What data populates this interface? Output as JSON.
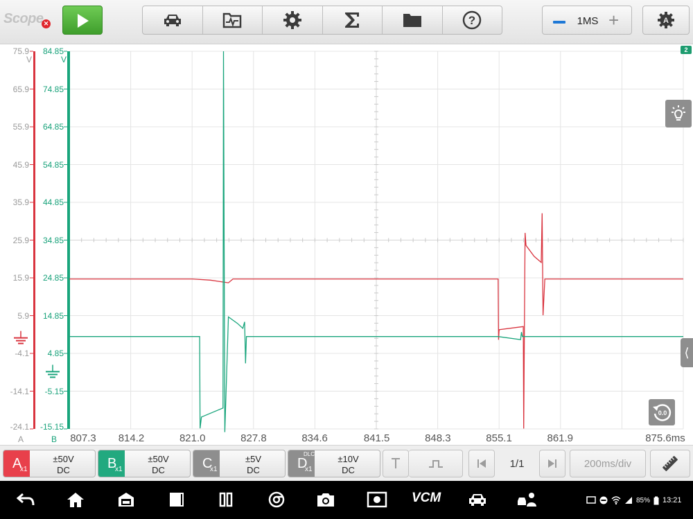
{
  "app": {
    "title": "Scope",
    "status_icon": "error-badge-icon"
  },
  "toolbar": {
    "run_icon": "play-icon",
    "tools": [
      {
        "name": "vehicle",
        "icon": "car-icon"
      },
      {
        "name": "waveform-library",
        "icon": "waveform-folder-icon"
      },
      {
        "name": "settings",
        "icon": "gear-icon"
      },
      {
        "name": "math",
        "icon": "sigma-icon"
      },
      {
        "name": "files",
        "icon": "folder-icon"
      },
      {
        "name": "help",
        "icon": "help-icon"
      }
    ],
    "timebase": {
      "value": "1MS",
      "minus_icon": "minus-icon",
      "plus_icon": "plus-icon"
    },
    "scope_settings_icon": "scope-settings-icon"
  },
  "plot": {
    "channel_a_labels": [
      "75.9",
      "65.9",
      "55.9",
      "45.9",
      "35.9",
      "25.9",
      "15.9",
      "5.9",
      "-4.1",
      "-14.1",
      "-24.1"
    ],
    "channel_b_labels": [
      "84.85",
      "74.85",
      "64.85",
      "54.85",
      "44.85",
      "34.85",
      "24.85",
      "14.85",
      "4.85",
      "-5.15",
      "-15.15"
    ],
    "unit_a": "V",
    "unit_b": "V",
    "x_labels": [
      "807.3",
      "814.2",
      "821.0",
      "827.8",
      "834.6",
      "841.5",
      "848.3",
      "855.1",
      "861.9",
      "875.6ms"
    ],
    "channel_a_name": "A",
    "channel_b_name": "B",
    "channel_b_badge": "2",
    "brightness_icon": "brightness-icon",
    "side_panel_icon": "chevron-left-icon",
    "reset_zoom_value": "0.0"
  },
  "chart_data": {
    "type": "line",
    "xlim": [
      807.3,
      875.6
    ],
    "x_unit": "ms",
    "series": [
      {
        "name": "A",
        "color": "#d9343f",
        "ylim": [
          -24.1,
          75.9
        ],
        "x": [
          807.3,
          821.0,
          823.0,
          825.0,
          825.5,
          855.0,
          855.05,
          855.1,
          855.15,
          857.8,
          857.85,
          858.0,
          858.1,
          859.0,
          859.8,
          859.9,
          860.0,
          860.2,
          875.6
        ],
        "y": [
          15.6,
          15.6,
          15.3,
          14.6,
          15.6,
          15.6,
          -0.5,
          1.8,
          2.2,
          3.0,
          -24.0,
          27.8,
          24.5,
          21.6,
          20.0,
          33.0,
          6.0,
          15.6,
          15.6
        ]
      },
      {
        "name": "B",
        "color": "#19a57c",
        "ylim": [
          -15.15,
          84.85
        ],
        "x": [
          807.3,
          821.8,
          821.85,
          822.0,
          824.4,
          824.45,
          824.6,
          825.0,
          826.0,
          826.6,
          826.8,
          826.9,
          827.0,
          827.2,
          855.0,
          857.5,
          857.6,
          857.7,
          875.6
        ],
        "y": [
          9.3,
          9.3,
          -15.0,
          -12.0,
          -9.6,
          84.85,
          -16.0,
          14.5,
          12.8,
          11.5,
          13.2,
          2.2,
          9.3,
          9.3,
          9.3,
          8.5,
          10.5,
          9.3,
          9.3
        ]
      }
    ]
  },
  "channels": [
    {
      "letter": "A",
      "probe": "x1",
      "range": "±50V",
      "coupling": "DC",
      "color": "#e8404b",
      "active": true
    },
    {
      "letter": "B",
      "probe": "x1",
      "range": "±50V",
      "coupling": "DC",
      "color": "#22a97f",
      "active": true
    },
    {
      "letter": "C",
      "probe": "x1",
      "range": "±5V",
      "coupling": "DC",
      "color": "#8e8e8e",
      "active": false
    },
    {
      "letter": "D",
      "probe": "x1",
      "badge": "DLC",
      "range": "±10V",
      "coupling": "DC",
      "color": "#8e8e8e",
      "active": false
    }
  ],
  "controls": {
    "trigger_icon": "trigger-icon",
    "trigger_mode_icon": "pulse-icon",
    "prev_icon": "skip-previous-icon",
    "page": "1/1",
    "next_icon": "skip-next-icon",
    "time_per_div": "200ms/div",
    "measure_icon": "ruler-icon"
  },
  "nav": {
    "buttons": [
      "back-icon",
      "home-icon",
      "garage-icon",
      "tablet-icon",
      "recent-apps-icon",
      "chrome-icon",
      "camera-icon",
      "screenshot-icon",
      "vcm-icon",
      "car-icon",
      "person-car-icon"
    ],
    "vcm_label": "VCM",
    "battery": "85%",
    "clock": "13:21"
  }
}
